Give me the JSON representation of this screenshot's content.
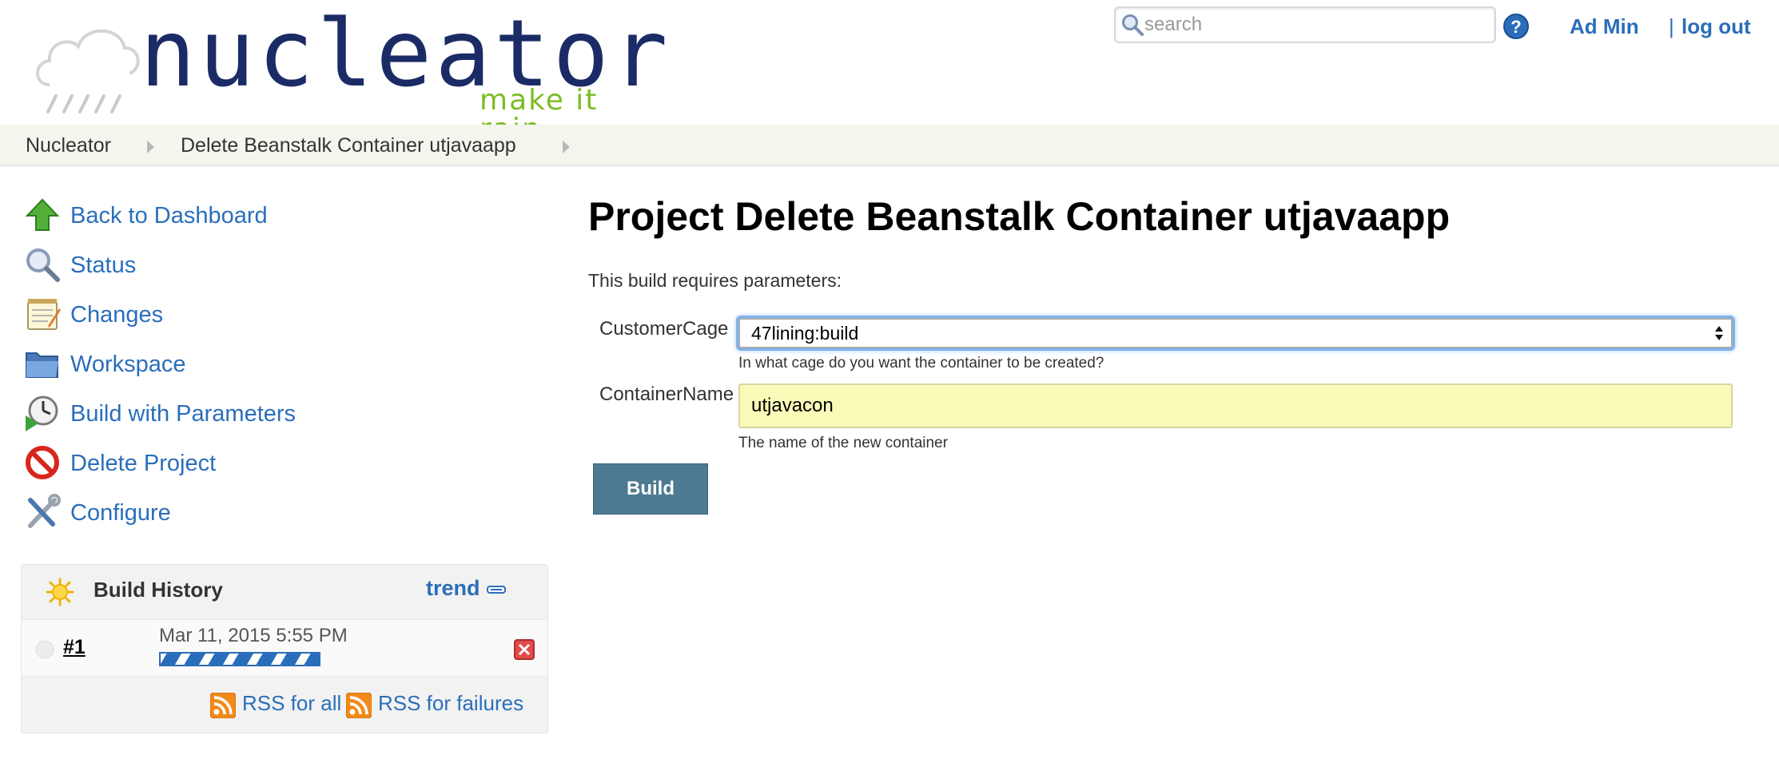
{
  "header": {
    "logo_text": "nucleator",
    "tagline": "make it rain.",
    "search_placeholder": "search",
    "user_name": "Ad Min",
    "logout_separator": "|",
    "logout_label": "log out"
  },
  "breadcrumb": [
    "Nucleator",
    "Delete Beanstalk Container utjavaapp"
  ],
  "sidebar": {
    "tasks": [
      {
        "label": "Back to Dashboard",
        "icon": "up-arrow-icon"
      },
      {
        "label": "Status",
        "icon": "magnifier-icon"
      },
      {
        "label": "Changes",
        "icon": "notepad-icon"
      },
      {
        "label": "Workspace",
        "icon": "folder-icon"
      },
      {
        "label": "Build with Parameters",
        "icon": "clock-play-icon"
      },
      {
        "label": "Delete Project",
        "icon": "no-entry-icon"
      },
      {
        "label": "Configure",
        "icon": "wrench-screwdriver-icon"
      }
    ],
    "build_history": {
      "title": "Build History",
      "trend_label": "trend",
      "builds": [
        {
          "number": "#1",
          "date": "Mar 11, 2015 5:55 PM",
          "progress": 1.0
        }
      ],
      "rss_all_label": "RSS for all",
      "rss_failures_label": "RSS for failures"
    }
  },
  "main": {
    "title": "Project Delete Beanstalk Container utjavaapp",
    "params_intro": "This build requires parameters:",
    "params": [
      {
        "name": "CustomerCage",
        "value": "47lining:build",
        "description": "In what cage do you want the container to be created?"
      },
      {
        "name": "ContainerName",
        "value": "utjavacon",
        "description": "The name of the new container"
      }
    ],
    "build_button_label": "Build"
  },
  "colors": {
    "link": "#2a6ebb",
    "logo_text": "#1b2b66",
    "tagline": "#7cbd24",
    "breadcrumb_bg": "#f4f6ee",
    "build_button": "#4d7a92",
    "input_highlight": "#fafab9"
  }
}
